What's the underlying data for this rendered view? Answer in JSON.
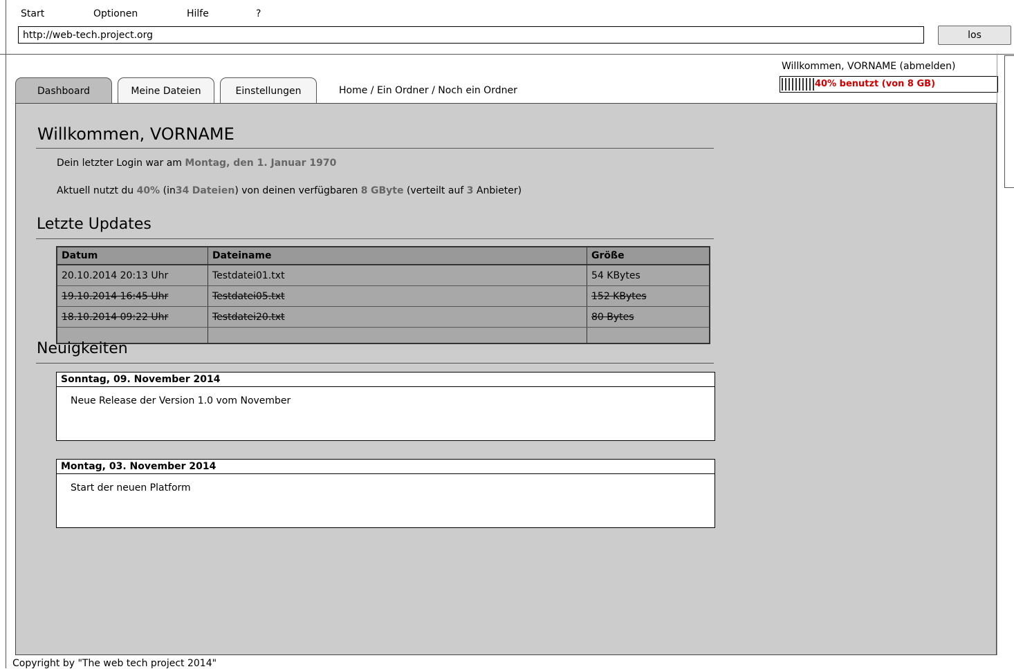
{
  "menu": {
    "start": "Start",
    "options": "Optionen",
    "help": "Hilfe",
    "question": "?"
  },
  "address": {
    "url": "http://web-tech.project.org",
    "go_label": "los"
  },
  "user": {
    "welcome": "Willkommen, VORNAME (abmelden)",
    "quota_text": "40% benutzt (von 8 GB)",
    "quota_fraction": 0.4
  },
  "tabs": [
    "Dashboard",
    "Meine Dateien",
    "Einstellungen"
  ],
  "breadcrumb": "Home / Ein Ordner / Noch ein Ordner",
  "welcome": {
    "heading": "Willkommen, VORNAME",
    "login_prefix": "Dein letzter Login war am",
    "login_date": "Montag, den 1. Januar 1970",
    "usage_prefix": "Aktuell nutzt du",
    "usage_percent": "40%",
    "usage_in": "(in",
    "usage_count": "34",
    "usage_files": "Dateien",
    "usage_mid": ") von deinen verfügbaren",
    "usage_size": "8",
    "usage_unit": "GByte",
    "usage_spread": "(verteilt auf",
    "usage_providers": "3",
    "usage_end": "Anbieter)"
  },
  "updates": {
    "heading": "Letzte Updates",
    "columns": [
      "Datum",
      "Dateiname",
      "Größe"
    ],
    "rows": [
      [
        "20.10.2014 20:13 Uhr",
        "Testdatei01.txt",
        "54 KBytes"
      ],
      [
        "19.10.2014 16:45 Uhr",
        "Testdatei05.txt",
        "152 KBytes"
      ],
      [
        "18.10.2014 09:22 Uhr",
        "Testdatei20.txt",
        "80 Bytes"
      ]
    ]
  },
  "news": {
    "heading": "Neuigkeiten",
    "items": [
      {
        "date": "Sonntag, 09. November 2014",
        "text": "Neue Release der Version 1.0 vom November"
      },
      {
        "date": "Montag, 03. November 2014",
        "text": "Start der neuen Platform"
      }
    ]
  },
  "footer": "Copyright by \"The web tech project 2014\""
}
